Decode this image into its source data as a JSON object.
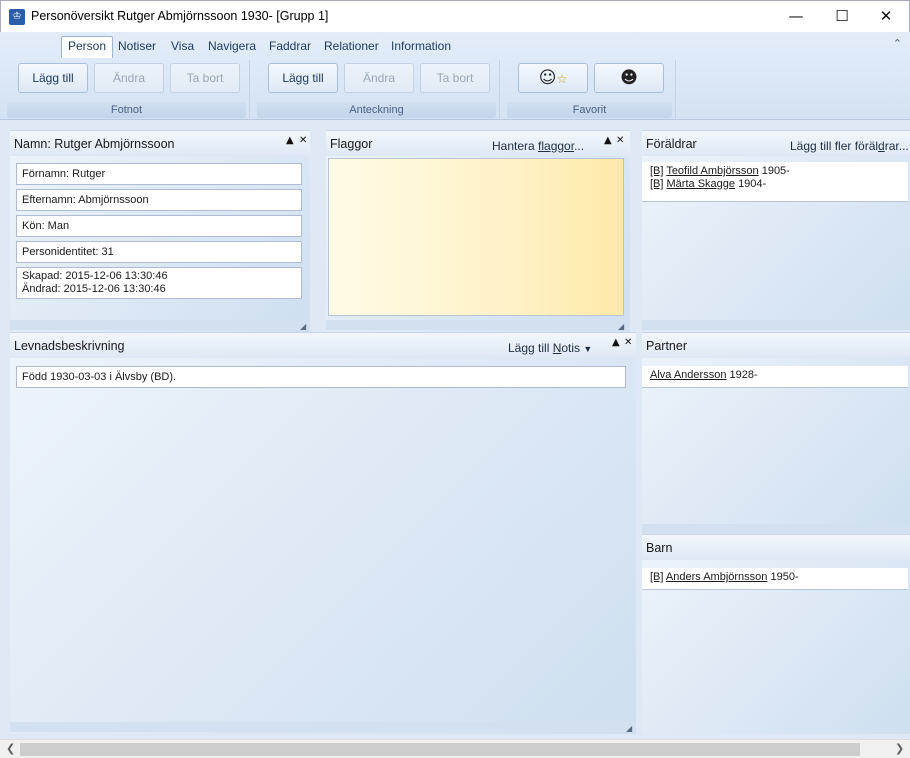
{
  "window": {
    "title": "Personöversikt Rutger Abmjörnssoon 1930- [Grupp 1]",
    "minimize": "—",
    "maximize": "☐",
    "close": "✕"
  },
  "ribbon": {
    "tabs": [
      {
        "label": "Person",
        "active": true
      },
      {
        "label": "Notiser"
      },
      {
        "label": "Visa"
      },
      {
        "label": "Navigera"
      },
      {
        "label": "Faddrar"
      },
      {
        "label": "Relationer"
      },
      {
        "label": "Information"
      }
    ],
    "groups": {
      "fotnot": {
        "label": "Fotnot",
        "add": "Lägg till",
        "edit": "Ändra",
        "remove": "Ta bort"
      },
      "anteckning": {
        "label": "Anteckning",
        "add": "Lägg till",
        "edit": "Ändra",
        "remove": "Ta bort"
      },
      "favorit": {
        "label": "Favorit",
        "icon1": "☺",
        "icon2": "☻"
      }
    }
  },
  "person_panel": {
    "title": "Namn: Rutger Abmjörnssoon",
    "fields": {
      "fornamn": "Förnamn: Rutger",
      "efternamn": "Efternamn: Abmjörnssoon",
      "kon": "Kön: Man",
      "personidentitet": "Personidentitet: 31",
      "skapad": "Skapad: 2015-12-06 13:30:46",
      "andrad": "Ändrad: 2015-12-06 13:30:46"
    }
  },
  "flags_panel": {
    "title": "Flaggor",
    "link_prefix": "Hantera ",
    "link_underlined": "flaggor",
    "link_suffix": "..."
  },
  "parents_panel": {
    "title": "Föräldrar",
    "link_prefix": "Lägg till fler föräl",
    "link_underlined": "d",
    "link_suffix": "rar...",
    "items": [
      {
        "tag": "[B]",
        "name": "Teofild Ambjörsson",
        "year": "1905-"
      },
      {
        "tag": "[B]",
        "name": "Märta Skagge",
        "year": "1904-"
      }
    ]
  },
  "life_panel": {
    "title": "Levnadsbeskrivning",
    "link_prefix": "Lägg till ",
    "link_underlined": "N",
    "link_suffix": "otis",
    "text": "Född 1930-03-03 i Älvsby (BD)."
  },
  "partner_panel": {
    "title": "Partner",
    "name": "Alva Andersson",
    "year": "1928-"
  },
  "children_panel": {
    "title": "Barn",
    "tag": "[B]",
    "name": "Anders Ambjörnsson",
    "year": "1950-"
  }
}
